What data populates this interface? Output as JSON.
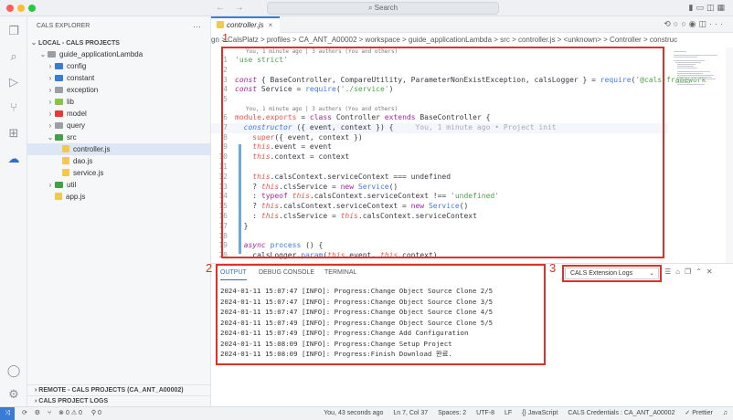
{
  "window": {
    "search_placeholder": "Search",
    "nav_back": "←",
    "nav_forward": "→"
  },
  "sidebar": {
    "title": "CALS EXPLORER",
    "more": "···",
    "section_local": "LOCAL - CALS PROJECTS",
    "tree": [
      {
        "label": "guide_applicationLambda",
        "type": "folder",
        "expanded": true,
        "depth": 1,
        "color": "#9aa0a6"
      },
      {
        "label": "config",
        "type": "folder",
        "expanded": false,
        "depth": 2,
        "color": "#3a7bd5"
      },
      {
        "label": "constant",
        "type": "folder",
        "expanded": false,
        "depth": 2,
        "color": "#3a7bd5"
      },
      {
        "label": "exception",
        "type": "folder",
        "expanded": false,
        "depth": 2,
        "color": "#9aa0a6"
      },
      {
        "label": "lib",
        "type": "folder",
        "expanded": false,
        "depth": 2,
        "color": "#8bc34a"
      },
      {
        "label": "model",
        "type": "folder",
        "expanded": false,
        "depth": 2,
        "color": "#e53935"
      },
      {
        "label": "query",
        "type": "folder",
        "expanded": false,
        "depth": 2,
        "color": "#9aa0a6"
      },
      {
        "label": "src",
        "type": "folder",
        "expanded": true,
        "depth": 2,
        "color": "#43a047"
      },
      {
        "label": "controller.js",
        "type": "file",
        "depth": 3,
        "selected": true
      },
      {
        "label": "dao.js",
        "type": "file",
        "depth": 3
      },
      {
        "label": "service.js",
        "type": "file",
        "depth": 3
      },
      {
        "label": "util",
        "type": "folder",
        "expanded": false,
        "depth": 2,
        "color": "#43a047"
      },
      {
        "label": "app.js",
        "type": "file",
        "depth": 2
      }
    ],
    "section_remote": "REMOTE - CALS PROJECTS (CA_ANT_A00002)",
    "section_logs": "CALS PROJECT LOGS"
  },
  "editor": {
    "tab_label": "controller.js",
    "tab_close": "×",
    "breadcrumb": "gn > CalsPlatz > profiles > CA_ANT_A00002 > workspace > guide_applicationLambda > src > controller.js > <unknown> > Controller > construc",
    "lens_1": "You, 1 minute ago | 3 authors (You and others)",
    "lens_2": "You, 1 minute ago | 3 authors (You and others)",
    "ghost_text": "You, 1 minute ago • Project init",
    "line_numbers": [
      "1",
      "2",
      "3",
      "4",
      "5",
      "6",
      "7",
      "8",
      "9",
      "10",
      "11",
      "12",
      "13",
      "14",
      "15",
      "16",
      "17",
      "18",
      "19",
      "20"
    ]
  },
  "panel": {
    "tabs": [
      "OUTPUT",
      "DEBUG CONSOLE",
      "TERMINAL"
    ],
    "active_tab": "OUTPUT",
    "log_channel": "CALS Extension Logs",
    "logs": [
      "2024-01-11 15:07:47 [INFO]: Progress:Change Object Source Clone 2/5",
      "2024-01-11 15:07:47 [INFO]: Progress:Change Object Source Clone 3/5",
      "2024-01-11 15:07:47 [INFO]: Progress:Change Object Source Clone 4/5",
      "2024-01-11 15:07:49 [INFO]: Progress:Change Object Source Clone 5/5",
      "2024-01-11 15:07:49 [INFO]: Progress:Change Add Configuration",
      "2024-01-11 15:08:09 [INFO]: Progress:Change Setup Project",
      "2024-01-11 15:08:09 [INFO]: Progress:Finish Download 완료."
    ]
  },
  "annotations": [
    "1",
    "2",
    "3"
  ],
  "status": {
    "problems": "⊗ 0 ⚠ 0",
    "ports": "⚲ 0",
    "blame": "You, 43 seconds ago",
    "position": "Ln 7, Col 37",
    "spaces": "Spaces: 2",
    "encoding": "UTF-8",
    "eol": "LF",
    "language": "{} JavaScript",
    "credentials": "CALS Credentials : CA_ANT_A00002",
    "prettier": "✓ Prettier"
  },
  "colors": {
    "accent": "#3b7ee0",
    "annotation": "#e0302a"
  }
}
